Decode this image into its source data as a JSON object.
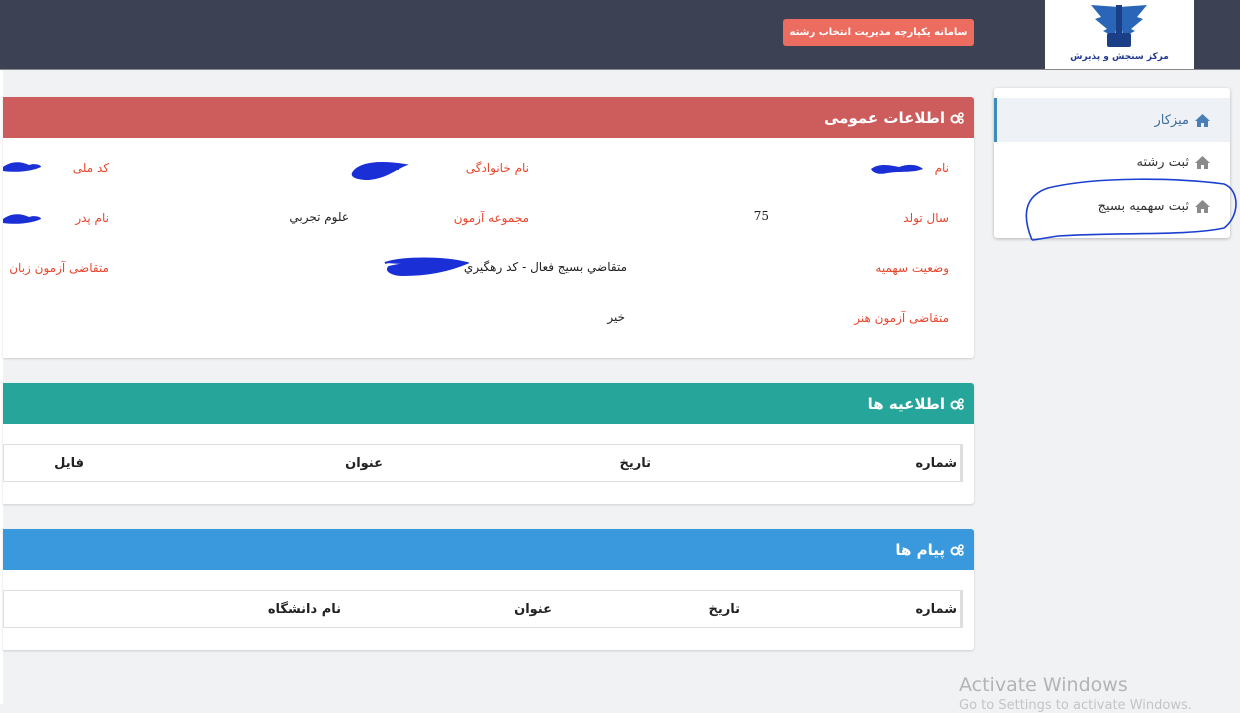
{
  "header": {
    "system_button": "سامانه یکپارچه مدیریت انتخاب رشته",
    "logo_caption": "مرکز سنجش و پذیرش"
  },
  "sidebar": {
    "items": [
      {
        "label": "میزکار",
        "icon": "home-icon"
      },
      {
        "label": "ثبت رشته",
        "icon": "home-icon"
      },
      {
        "label": "ثبت سهمیه بسیج",
        "icon": "home-icon"
      }
    ]
  },
  "general_info": {
    "title": "اطلاعات عمومی",
    "name_label": "نام",
    "family_label": "نام خانوادگی",
    "national_code_label": "کد ملی",
    "birth_year_label": "سال تولد",
    "birth_year_value": "75",
    "exam_group_label": "مجموعه آزمون",
    "exam_group_value": "علوم تجربي",
    "father_label": "نام پدر",
    "quota_label": "وضعیت سهمیه",
    "quota_value": "متقاضي بسيج فعال - کد رهگيري",
    "language_label": "متقاضی آزمون زبان",
    "art_label": "متقاضی آزمون هنر",
    "art_value": "خیر"
  },
  "announcements": {
    "title": "اطلاعیه ها",
    "columns": [
      "شماره",
      "تاریخ",
      "عنوان",
      "فایل"
    ]
  },
  "messages": {
    "title": "پیام ها",
    "columns": [
      "شماره",
      "تاریخ",
      "عنوان",
      "نام دانشگاه"
    ]
  },
  "watermark": {
    "line1": "Activate Windows",
    "line2": "Go to Settings to activate Windows."
  },
  "colors": {
    "header_bg": "#3d4154",
    "general_head": "#cd5c5c",
    "announce_head": "#26a69a",
    "messages_head": "#3a98dc",
    "label_red": "#e8472e"
  }
}
